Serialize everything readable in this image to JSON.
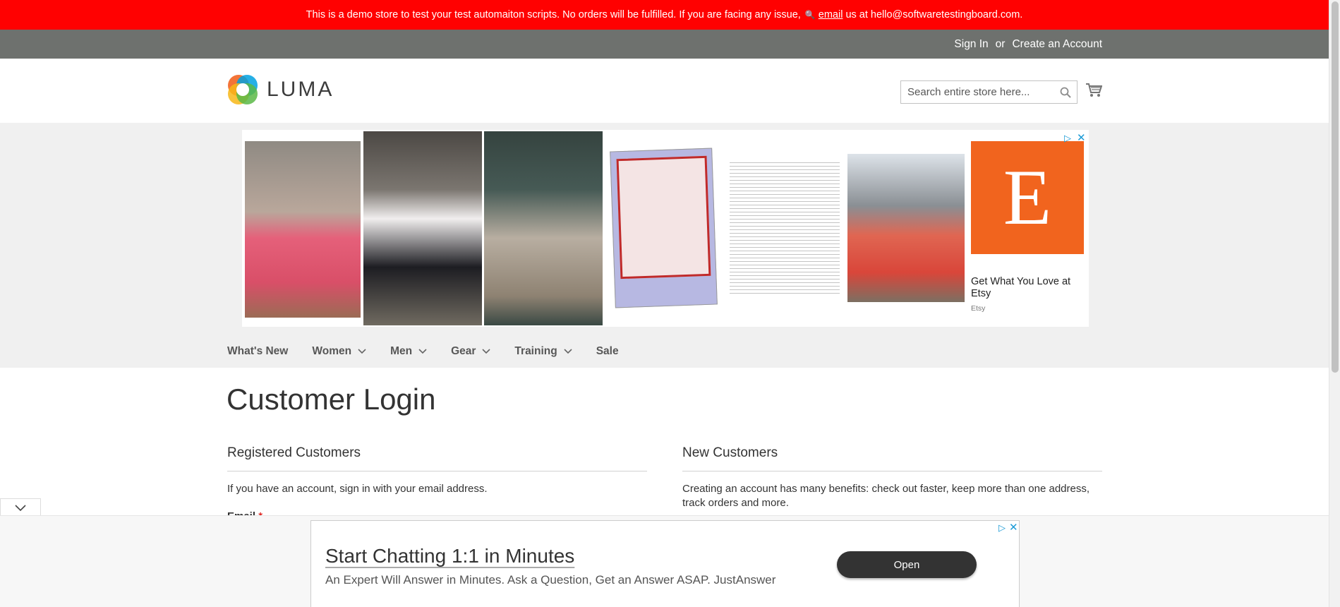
{
  "demo_notice": {
    "text_before": "This is a demo store to test your test automaiton scripts. No orders will be fulfilled. If you are facing any issue,",
    "link_text": "email",
    "text_after": "us at hello@softwaretestingboard.com."
  },
  "top_links": {
    "sign_in": "Sign In",
    "separator": "or",
    "create_account": "Create an Account"
  },
  "header": {
    "logo_text": "LUMA",
    "search_placeholder": "Search entire store here..."
  },
  "top_ad": {
    "etsy_letter": "E",
    "etsy_title": "Get What You Love at Etsy",
    "etsy_source": "Etsy"
  },
  "nav": {
    "items": [
      {
        "label": "What's New",
        "dropdown": false
      },
      {
        "label": "Women",
        "dropdown": true
      },
      {
        "label": "Men",
        "dropdown": true
      },
      {
        "label": "Gear",
        "dropdown": true
      },
      {
        "label": "Training",
        "dropdown": true
      },
      {
        "label": "Sale",
        "dropdown": false
      }
    ]
  },
  "page": {
    "title": "Customer Login",
    "registered": {
      "title": "Registered Customers",
      "text": "If you have an account, sign in with your email address.",
      "email_label": "Email",
      "required_mark": "*"
    },
    "new_customers": {
      "title": "New Customers",
      "text": "Creating an account has many benefits: check out faster, keep more than one address, track orders and more."
    }
  },
  "bottom_ad": {
    "headline": "Start Chatting 1:1 in Minutes",
    "subtext": "An Expert Will Answer in Minutes. Ask a Question, Get an Answer ASAP. JustAnswer",
    "button": "Open"
  },
  "colors": {
    "demo_bar": "#ff0101",
    "top_links_bar": "#6e716e",
    "etsy_orange": "#f1641e",
    "adchoices_blue": "#1a9ad6"
  }
}
